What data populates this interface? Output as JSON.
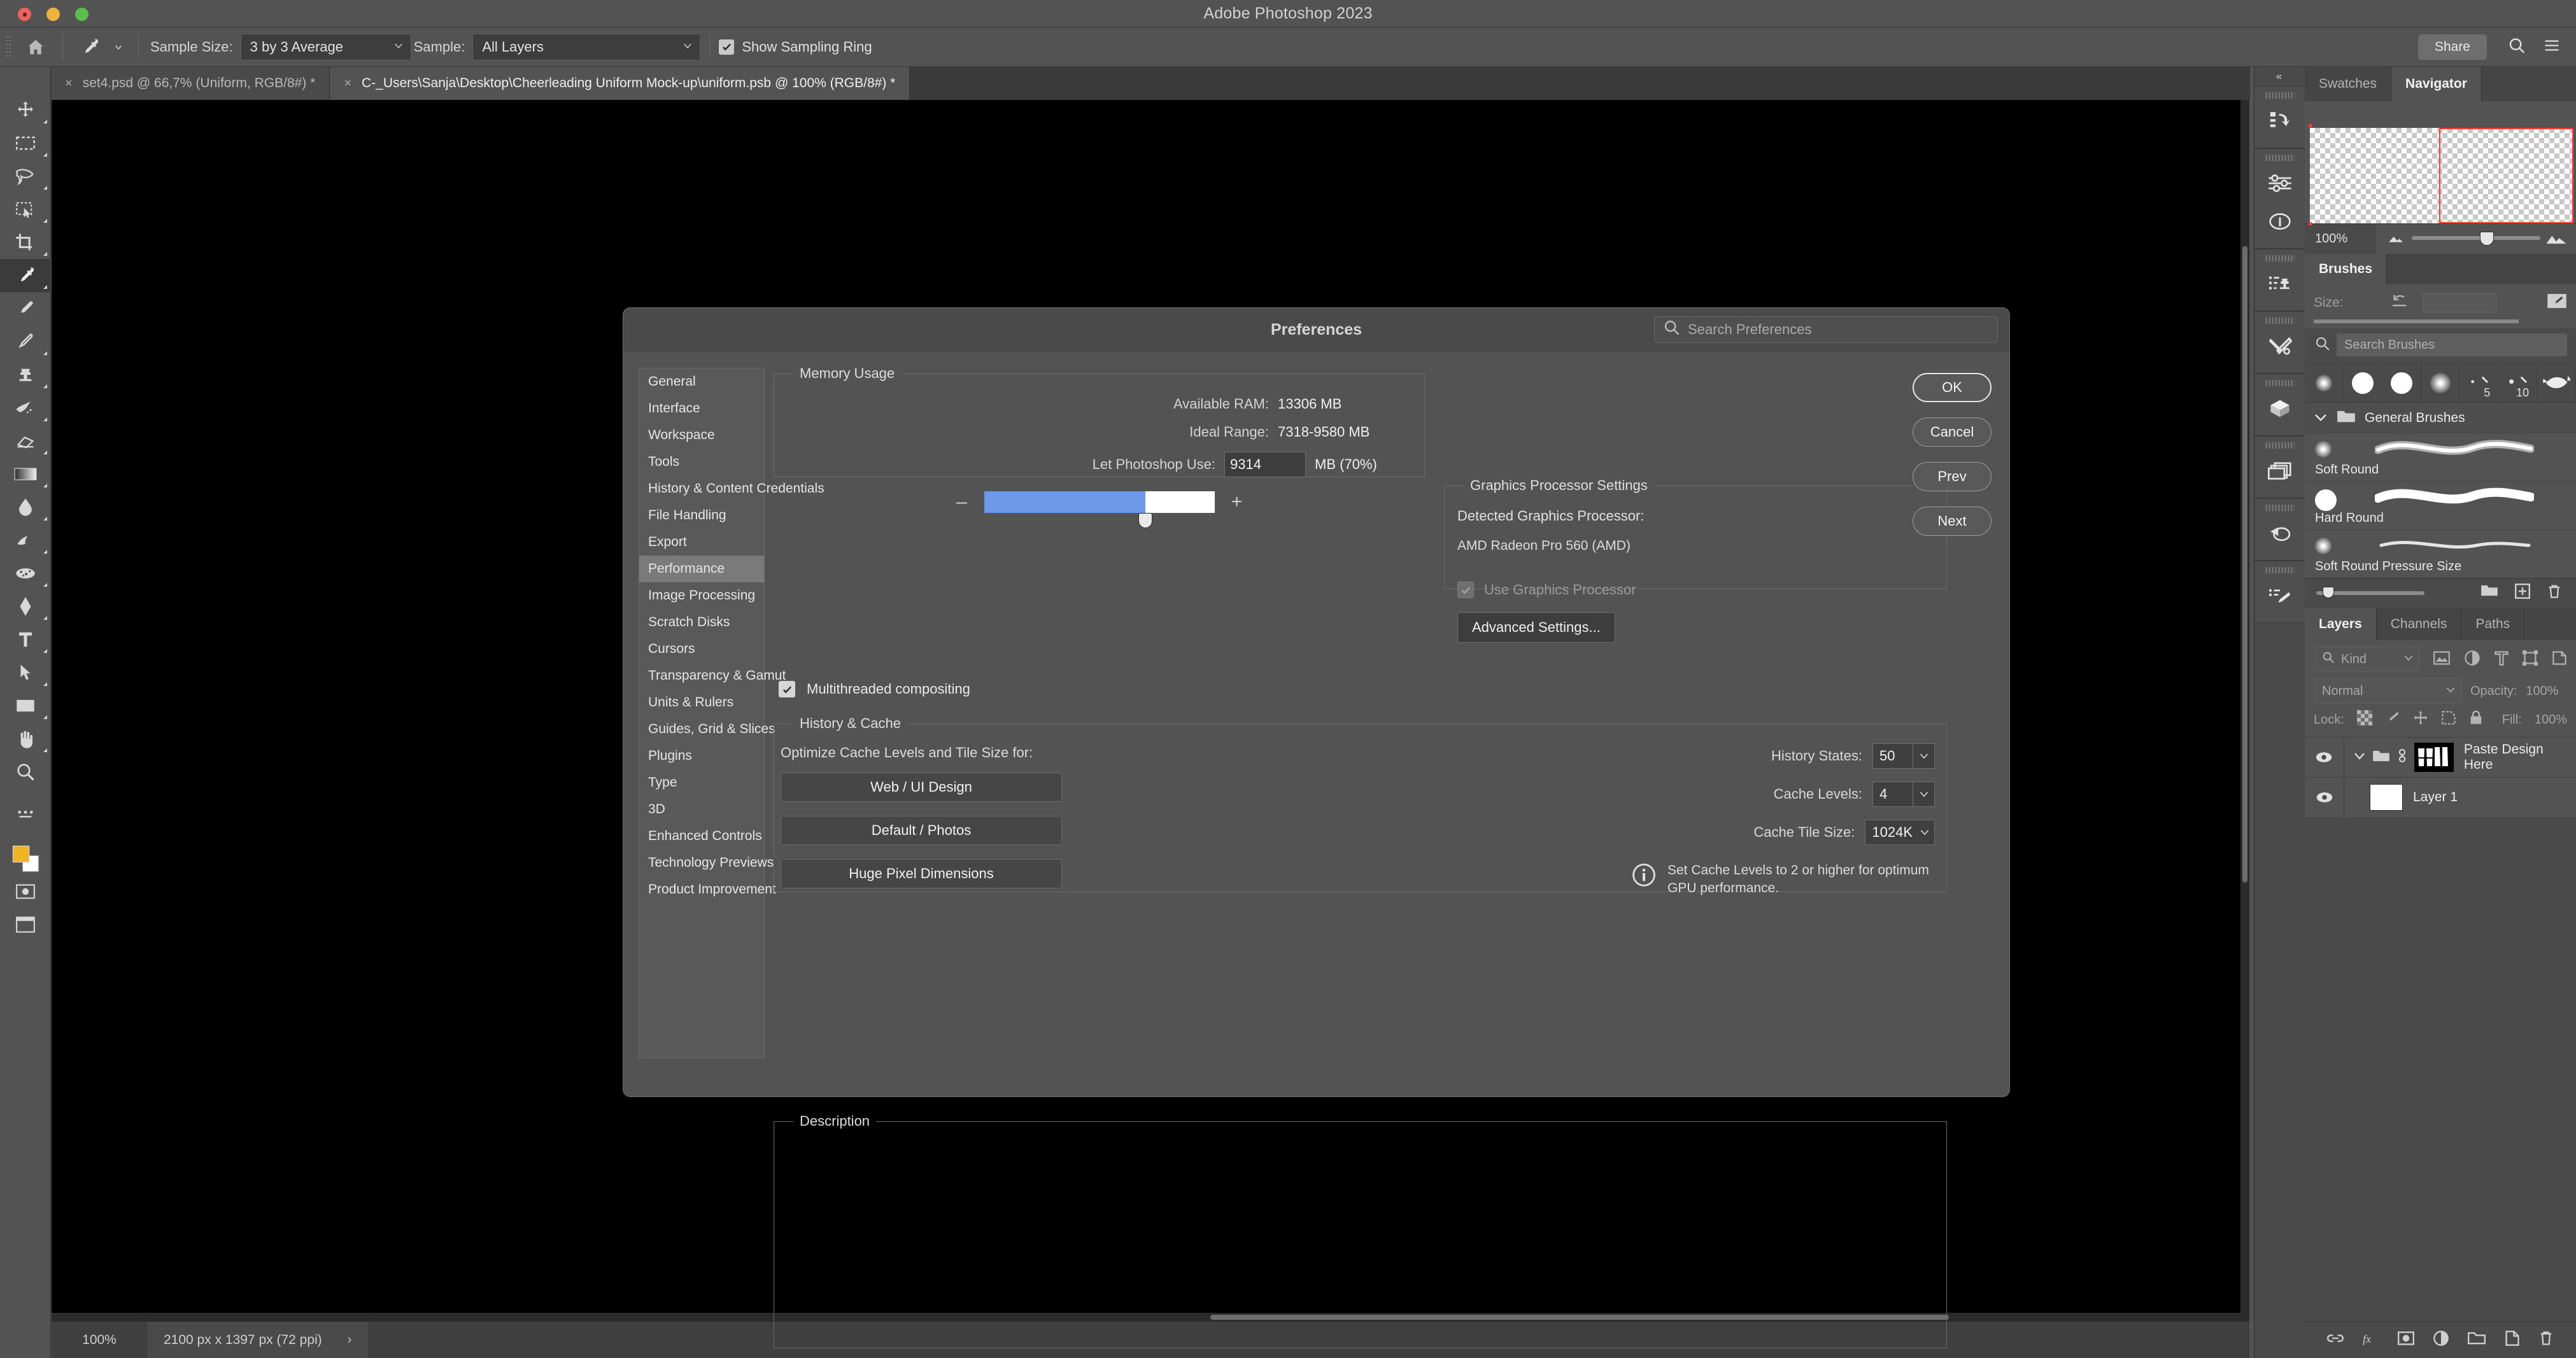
{
  "window": {
    "title": "Adobe Photoshop 2023"
  },
  "options_bar": {
    "tool_icon": "eyedropper-tool-icon",
    "brush_preset_icon": "brush-preset-icon",
    "sample_size_label": "Sample Size:",
    "sample_size_value": "3 by 3 Average",
    "sample_label": "Sample:",
    "sample_value": "All Layers",
    "show_sampling_ring_label": "Show Sampling Ring",
    "show_sampling_ring_checked": true,
    "share_label": "Share",
    "search_icon": "search-icon",
    "menu_icon": "hamburger-menu-icon",
    "home_icon": "home-icon"
  },
  "document_tabs": [
    {
      "label": "set4.psd @ 66,7% (Uniform, RGB/8#) *",
      "active": false,
      "close": "×"
    },
    {
      "label": "C-_Users\\Sanja\\Desktop\\Cheerleading Uniform Mock-up\\uniform.psb @ 100% (RGB/8#) *",
      "active": true,
      "close": "×"
    }
  ],
  "toolbar_tools": [
    "move-tool-icon",
    "rectangular-marquee-tool-icon",
    "lasso-tool-icon",
    "object-selection-tool-icon",
    "crop-tool-icon",
    "eyedropper-tool-icon",
    "spot-healing-brush-tool-icon",
    "brush-tool-icon",
    "clone-stamp-tool-icon",
    "history-brush-tool-icon",
    "eraser-tool-icon",
    "gradient-tool-icon",
    "blur-tool-icon",
    "dodge-tool-icon",
    "pen-tool-icon",
    "type-tool-icon",
    "path-selection-tool-icon",
    "rectangle-tool-icon",
    "hand-tool-icon",
    "zoom-tool-icon",
    "edit-toolbar-icon",
    "foreground-background-color-icon",
    "quick-mask-icon",
    "screen-mode-icon"
  ],
  "status_bar": {
    "zoom": "100%",
    "dimensions": "2100 px x 1397 px (72 ppi)",
    "expand_arrow": "›"
  },
  "right_rail": {
    "collapse_label": "«",
    "icons": [
      "history-undo-icon",
      "adjustments-icon",
      "info-icon",
      "actions-icon",
      "tools-icon",
      "3d-cube-icon",
      "layer-comps-icon",
      "revert-icon",
      "brush-list-icon"
    ]
  },
  "navigator_panel": {
    "tabs": [
      {
        "label": "Swatches",
        "active": false
      },
      {
        "label": "Navigator",
        "active": true
      }
    ],
    "zoom_value": "100%",
    "zoom_out_icon": "zoom-out-mountain-icon",
    "zoom_in_icon": "zoom-in-mountain-icon"
  },
  "brushes_panel": {
    "tabs": [
      {
        "label": "Brushes",
        "active": true
      }
    ],
    "size_label": "Size:",
    "reset_icon": "reset-arrow-icon",
    "size_value": "",
    "new_brush_icon": "new-brush-icon",
    "search_placeholder": "Search Brushes",
    "search_icon": "search-icon",
    "quick_thumbs": [
      {
        "kind": "soft",
        "label": ""
      },
      {
        "kind": "hard",
        "label": ""
      },
      {
        "kind": "hard",
        "label": ""
      },
      {
        "kind": "soft",
        "label": ""
      },
      {
        "kind": "tip",
        "label": "5"
      },
      {
        "kind": "tip",
        "label": "10"
      },
      {
        "kind": "splatter",
        "label": ""
      }
    ],
    "group": {
      "name": "General Brushes",
      "expanded": true,
      "folder_icon": "folder-icon",
      "chevron_icon": "chevron-down-icon"
    },
    "brushes": [
      {
        "name": "Soft Round",
        "kind": "soft"
      },
      {
        "name": "Hard Round",
        "kind": "hard"
      },
      {
        "name": "Soft Round Pressure Size",
        "kind": "soft-pressure"
      }
    ],
    "footer_icons": [
      "new-group-icon",
      "new-brush-icon",
      "delete-brush-icon"
    ]
  },
  "layers_panel": {
    "tabs": [
      {
        "label": "Layers",
        "active": true
      },
      {
        "label": "Channels",
        "active": false
      },
      {
        "label": "Paths",
        "active": false
      }
    ],
    "filter_label": "Kind",
    "filter_icons": [
      "pixel-layer-filter-icon",
      "adjustment-layer-filter-icon",
      "type-layer-filter-icon",
      "shape-layer-filter-icon",
      "smart-object-filter-icon"
    ],
    "blend_mode": "Normal",
    "opacity_label": "Opacity:",
    "opacity_value": "100%",
    "lock_label": "Lock:",
    "lock_icons": [
      "lock-transparent-pixels-icon",
      "lock-image-pixels-icon",
      "lock-position-icon",
      "lock-artboard-icon",
      "lock-all-icon"
    ],
    "fill_label": "Fill:",
    "fill_value": "100%",
    "rows": [
      {
        "name": "Paste Design Here",
        "type": "group",
        "visible": true,
        "eye_icon": "eye-icon",
        "chevron_icon": "chevron-down-icon",
        "folder_icon": "folder-icon",
        "link_icon": "link-icon"
      },
      {
        "name": "Layer 1",
        "type": "layer",
        "visible": true,
        "eye_icon": "eye-icon"
      }
    ],
    "footer_icons": [
      "link-layers-icon",
      "layer-style-fx-icon",
      "add-mask-icon",
      "adjustment-layer-icon",
      "new-group-icon",
      "new-layer-icon",
      "delete-layer-icon"
    ]
  },
  "preferences_dialog": {
    "title": "Preferences",
    "search_placeholder": "Search Preferences",
    "search_icon": "search-icon",
    "sidebar": [
      {
        "label": "General",
        "active": false
      },
      {
        "label": "Interface",
        "active": false
      },
      {
        "label": "Workspace",
        "active": false
      },
      {
        "label": "Tools",
        "active": false
      },
      {
        "label": "History & Content Credentials",
        "active": false
      },
      {
        "label": "File Handling",
        "active": false
      },
      {
        "label": "Export",
        "active": false
      },
      {
        "label": "Performance",
        "active": true
      },
      {
        "label": "Image Processing",
        "active": false
      },
      {
        "label": "Scratch Disks",
        "active": false
      },
      {
        "label": "Cursors",
        "active": false
      },
      {
        "label": "Transparency & Gamut",
        "active": false
      },
      {
        "label": "Units & Rulers",
        "active": false
      },
      {
        "label": "Guides, Grid & Slices",
        "active": false
      },
      {
        "label": "Plugins",
        "active": false
      },
      {
        "label": "Type",
        "active": false
      },
      {
        "label": "3D",
        "active": false
      },
      {
        "label": "Enhanced Controls",
        "active": false
      },
      {
        "label": "Technology Previews",
        "active": false
      },
      {
        "label": "Product Improvement",
        "active": false
      }
    ],
    "memory_usage": {
      "legend": "Memory Usage",
      "available_ram_label": "Available RAM:",
      "available_ram_value": "13306 MB",
      "ideal_range_label": "Ideal Range:",
      "ideal_range_value": "7318-9580 MB",
      "let_photoshop_use_label": "Let Photoshop Use:",
      "let_photoshop_use_value": "9314",
      "let_photoshop_use_suffix": "MB (70%)",
      "slider_percent": 70,
      "decrease_label": "–",
      "increase_label": "+",
      "slider_fill_color": "#6d9ae8"
    },
    "graphics_processor": {
      "legend": "Graphics Processor Settings",
      "detected_label": "Detected Graphics Processor:",
      "detected_value": "AMD Radeon Pro 560 (AMD)",
      "use_gpu_label": "Use Graphics Processor",
      "use_gpu_checked": true,
      "use_gpu_disabled": true,
      "advanced_settings_label": "Advanced Settings..."
    },
    "history_cache": {
      "legend": "History & Cache",
      "optimize_label": "Optimize Cache Levels and Tile Size for:",
      "preset_buttons": [
        "Web / UI Design",
        "Default / Photos",
        "Huge Pixel Dimensions"
      ],
      "history_states_label": "History States:",
      "history_states_value": "50",
      "cache_levels_label": "Cache Levels:",
      "cache_levels_value": "4",
      "cache_tile_size_label": "Cache Tile Size:",
      "cache_tile_size_value": "1024K",
      "info_icon": "info-icon",
      "note": "Set Cache Levels to 2 or higher for optimum GPU performance."
    },
    "multithreaded_label": "Multithreaded compositing",
    "multithreaded_checked": true,
    "description_legend": "Description",
    "description_text": "",
    "buttons": [
      {
        "label": "OK",
        "primary": true
      },
      {
        "label": "Cancel",
        "primary": false
      },
      {
        "label": "Prev",
        "primary": false
      },
      {
        "label": "Next",
        "primary": false
      }
    ]
  }
}
